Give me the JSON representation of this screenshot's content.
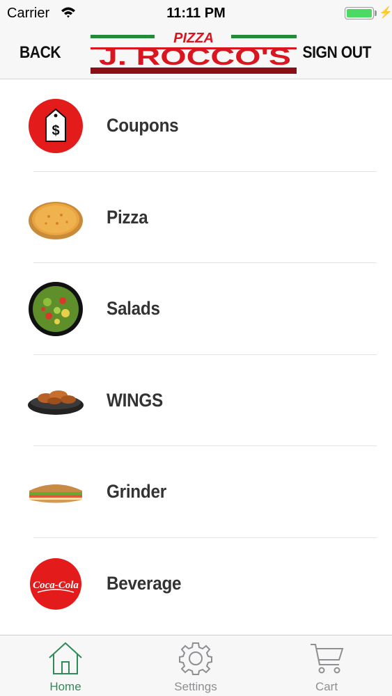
{
  "status_bar": {
    "carrier": "Carrier",
    "time": "11:11 PM",
    "battery_level": 1.0,
    "charging_glyph": "⚡"
  },
  "nav_bar": {
    "back_label": "BACK",
    "sign_out_label": "SIGN OUT",
    "logo": {
      "top_word": "PIZZA",
      "name": "J. ROCCO'S",
      "colors": {
        "red": "#d9161f",
        "green": "#238a3a",
        "dark_red": "#8a0e14"
      }
    }
  },
  "menu": {
    "items": [
      {
        "label": "Coupons",
        "icon": "coupon-tag-icon"
      },
      {
        "label": "Pizza",
        "icon": "pizza-image"
      },
      {
        "label": "Salads",
        "icon": "salad-bowl-image"
      },
      {
        "label": "WINGS",
        "icon": "wings-plate-image"
      },
      {
        "label": "Grinder",
        "icon": "grinder-sandwich-image"
      },
      {
        "label": "Beverage",
        "icon": "coca-cola-logo",
        "brand_text": "Coca-Cola"
      }
    ]
  },
  "tab_bar": {
    "active_color": "#2e8b57",
    "inactive_color": "#8e8e93",
    "tabs": [
      {
        "label": "Home",
        "icon": "home-icon",
        "active": true
      },
      {
        "label": "Settings",
        "icon": "gear-icon",
        "active": false
      },
      {
        "label": "Cart",
        "icon": "cart-icon",
        "active": false
      }
    ]
  }
}
